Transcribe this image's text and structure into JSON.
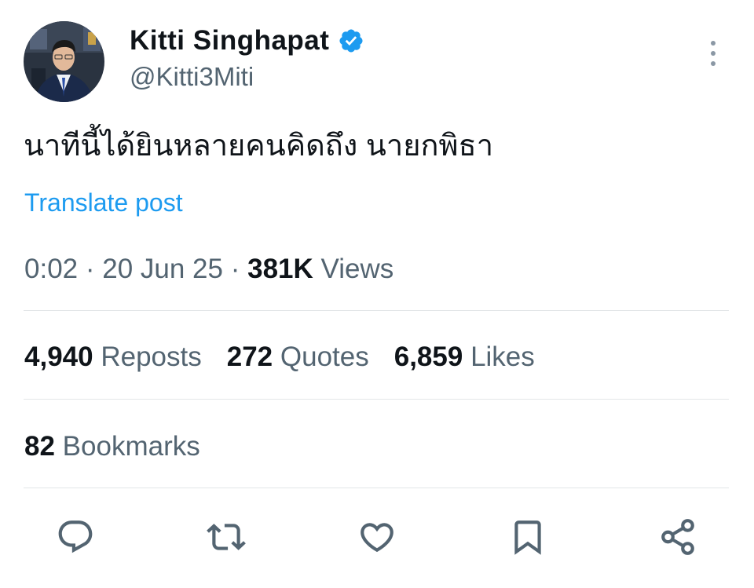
{
  "author": {
    "display_name": "Kitti Singhapat",
    "handle": "@Kitti3Miti",
    "verified": true,
    "verified_color": "#1d9bf0"
  },
  "post": {
    "text": "นาทีนี้ได้ยินหลายคนคิดถึง นายกพิธา",
    "translate_label": "Translate post"
  },
  "meta": {
    "time": "0:02",
    "separator": "·",
    "date": "20 Jun 25",
    "views_count": "381K",
    "views_label": "Views"
  },
  "stats": [
    {
      "count": "4,940",
      "label": "Reposts"
    },
    {
      "count": "272",
      "label": "Quotes"
    },
    {
      "count": "6,859",
      "label": "Likes"
    }
  ],
  "bookmarks": {
    "count": "82",
    "label": "Bookmarks"
  },
  "actions": [
    "reply-icon",
    "repost-icon",
    "like-icon",
    "bookmark-icon",
    "share-icon"
  ],
  "colors": {
    "text_primary": "#0f1419",
    "text_secondary": "#536471",
    "link": "#1d9bf0",
    "divider": "#e3e6e8"
  }
}
